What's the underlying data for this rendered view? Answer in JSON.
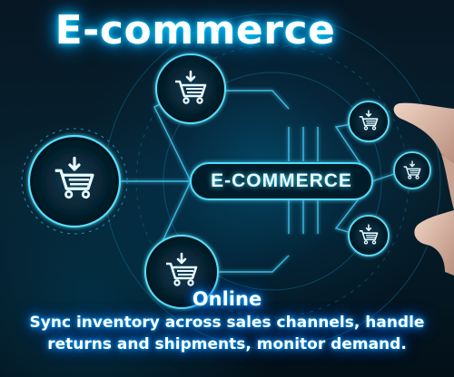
{
  "title": "E-commerce",
  "center_label": "E-COMMERCE",
  "subtitle": "Online",
  "description_lines": [
    "Sync inventory across sales channels, handle",
    "returns and shipments, monitor demand."
  ],
  "icons": [
    "shopping-cart-icon",
    "down-arrow-icon",
    "hand-icon"
  ],
  "colors": {
    "glow": "#00c8ff",
    "background": "#041019",
    "text": "#ffffff"
  }
}
